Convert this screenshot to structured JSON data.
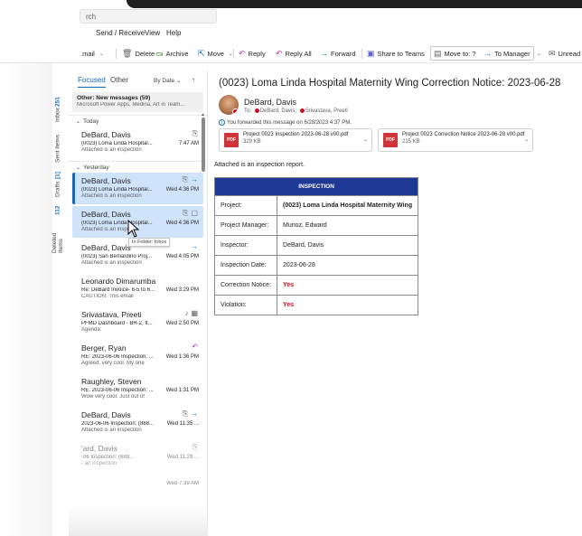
{
  "search": {
    "placeholder": "rch"
  },
  "menu": {
    "items": [
      "Send / Receive",
      "View",
      "Help"
    ]
  },
  "toolbar": {
    "new_mail": ".mail",
    "delete": "Delete",
    "archive": "Archive",
    "move": "Move",
    "reply": "Reply",
    "reply_all": "Reply All",
    "forward": "Forward",
    "share_teams": "Share to Teams",
    "move_to": "Move to: ?",
    "to_manager": "To Manager",
    "unread": "Unread"
  },
  "folders": [
    {
      "label": "Inbox",
      "count": "251"
    },
    {
      "label": "Sent Items",
      "count": ""
    },
    {
      "label": "Drafts",
      "count": "[1]"
    },
    {
      "label": "Deleted Items",
      "count": "112"
    }
  ],
  "list": {
    "tab_focused": "Focused",
    "tab_other": "Other",
    "sort": "By Date",
    "sort_arrow": "↑",
    "other_new": {
      "title": "Other: New messages (59)",
      "preview": "Microsoft Power Apps, Medina, Art in Team..."
    },
    "group_today": "Today",
    "group_yesterday": "Yesterday",
    "messages": [
      {
        "from": "DeBard, Davis",
        "subject": "(0023) Loma Linda Hospital...",
        "preview": "Attached is an inspection",
        "time": "7:47 AM"
      },
      {
        "from": "DeBard, Davis",
        "subject": "(0023) Loma Linda Hospital...",
        "preview": "Attached is an inspection",
        "time": "Wed 4:36 PM"
      },
      {
        "from": "DeBard, Davis",
        "subject": "(0023) Loma Linda Hospital...",
        "preview": "Attached is an inspe",
        "time": "Wed 4:36 PM"
      },
      {
        "from": "DeBard, Davis",
        "subject": "(0023) San Bernardino Proj...",
        "preview": "Attached is an inspection",
        "time": "Wed 4:05 PM"
      },
      {
        "from": "Leonardo Dimarumba",
        "subject": "Re: DeBard Invoice- 6-5 to 6...",
        "preview": "CAUTION: This email",
        "time": "Wed 3:29 PM"
      },
      {
        "from": "Srivastava, Preeti",
        "subject": "PFMD Dashboard - BR-2, It...",
        "preview": "Agenda:",
        "time": "Wed 2:50 PM"
      },
      {
        "from": "Berger, Ryan",
        "subject": "RE: 2023-06-06 Inspection: ...",
        "preview": "Agreed, very cool. My one",
        "time": "Wed 1:36 PM"
      },
      {
        "from": "Raughley, Steven",
        "subject": "RE: 2023-06-06 Inspection: ...",
        "preview": "Wow very cool. Just out of",
        "time": "Wed 1:31 PM"
      },
      {
        "from": "DeBard, Davis",
        "subject": "2023-06-06 Inspection: (888...",
        "preview": "Attached is an inspection",
        "time": "Wed 11:35 ..."
      },
      {
        "from": "'ard, Davis",
        "subject": "-06 Inspection: (888...",
        "preview": "- an inspection",
        "time": "Wed 11:29 ..."
      },
      {
        "from": "",
        "subject": "",
        "preview": "",
        "time": "Wed 7:39 AM"
      }
    ],
    "tooltip": "In Folder: Inbox"
  },
  "reading": {
    "subject": "(0023)  Loma Linda Hospital Maternity Wing Correction Notice: 2023-06-28",
    "sender": "DeBard, Davis",
    "to_label": "To:",
    "recipients": [
      "DeBard, Davis;",
      "Srivastava, Preeti"
    ],
    "forward_note": "You forwarded this message on 6/28/2023 4:37 PM.",
    "attachments": [
      {
        "name": "Project 0023 Inspection 2023-06-28 v00.pdf",
        "size": "329 KB",
        "type": "PDF"
      },
      {
        "name": "Project 0023 Correction Notice 2023-06-28 v00.pdf",
        "size": "215 KB",
        "type": "PDF"
      }
    ],
    "body": "Attached is an inspection report.",
    "table": {
      "header": "INSPECTION",
      "rows": [
        {
          "label": "Project:",
          "value": "(0023) Loma Linda Hospital Maternity Wing"
        },
        {
          "label": "Project Manager:",
          "value": "Munoz, Edward"
        },
        {
          "label": "Inspector:",
          "value": "DeBard, Davis"
        },
        {
          "label": "Inspection Date:",
          "value": "2023-06-28"
        },
        {
          "label": "Correction Notice:",
          "value": "Yes"
        },
        {
          "label": "Violation:",
          "value": "Yes"
        }
      ]
    }
  },
  "colors": {
    "accent": "#0f6cbd",
    "table_header": "#1f3896",
    "alert_red": "#c50f1f",
    "selected": "#cfe4fa"
  }
}
